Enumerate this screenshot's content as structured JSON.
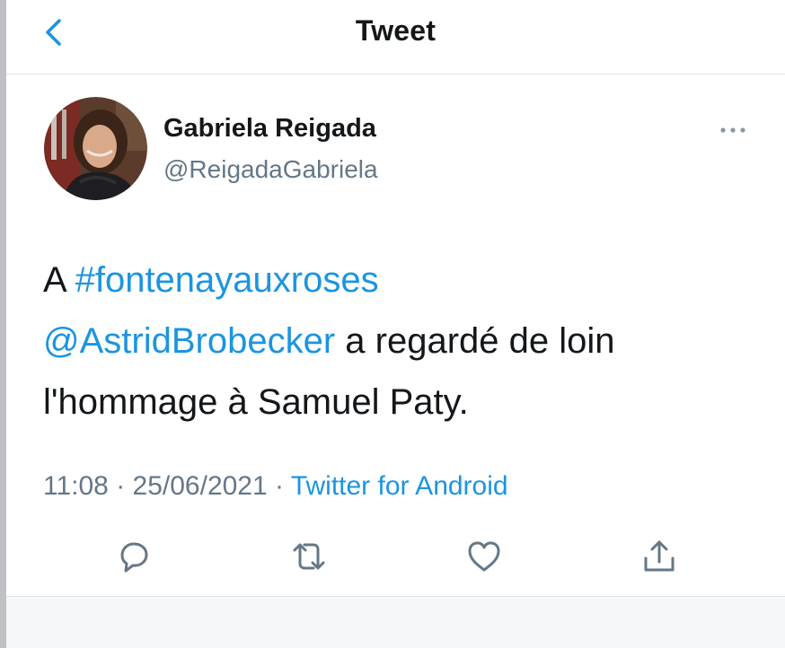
{
  "header": {
    "title": "Tweet",
    "back_icon": "chevron-left-icon"
  },
  "author": {
    "name": "Gabriela Reigada",
    "handle": "@ReigadaGabriela",
    "avatar": "avatar-photo"
  },
  "tweet": {
    "text_prefix": "A ",
    "hashtag": "#fontenayauxroses",
    "mention": "@AstridBrobecker",
    "text_suffix": " a regardé de loin l'hommage à Samuel Paty."
  },
  "meta": {
    "time": "11:08",
    "separator": " · ",
    "date": "25/06/2021",
    "source": "Twitter for Android"
  },
  "actions": {
    "reply_icon": "reply-icon",
    "retweet_icon": "retweet-icon",
    "like_icon": "heart-icon",
    "share_icon": "share-icon"
  },
  "colors": {
    "link": "#1b95e0",
    "secondary": "#657786",
    "text": "#14171a",
    "border": "#e1e5e8"
  }
}
